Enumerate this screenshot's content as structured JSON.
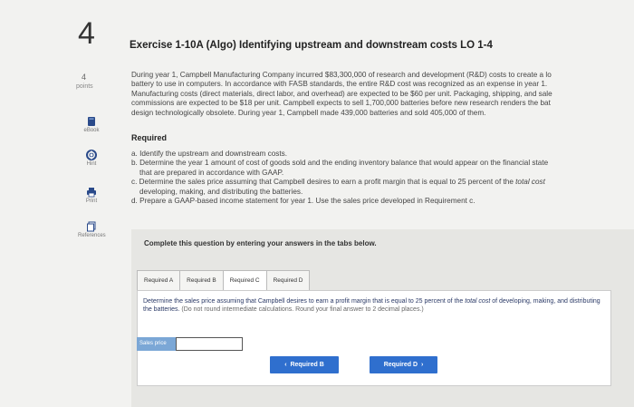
{
  "question": {
    "number": "4",
    "points_value": "4",
    "points_label": "points"
  },
  "sidebar": {
    "items": [
      {
        "label": "eBook",
        "icon": "book-icon"
      },
      {
        "label": "Hint",
        "icon": "lifebuoy-icon"
      },
      {
        "label": "Print",
        "icon": "print-icon"
      },
      {
        "label": "References",
        "icon": "references-icon"
      }
    ]
  },
  "exercise": {
    "title": "Exercise 1-10A (Algo) Identifying upstream and downstream costs LO 1-4",
    "paragraph_lines": [
      "During year 1, Campbell Manufacturing Company incurred $83,300,000 of research and development (R&D) costs to create a lo",
      "battery to use in computers. In accordance with FASB standards, the entire R&D cost was recognized as an expense in year 1.",
      "Manufacturing costs (direct materials, direct labor, and overhead) are expected to be $60 per unit. Packaging, shipping, and sale",
      "commissions are expected to be $18 per unit. Campbell expects to sell 1,700,000 batteries before new research renders the bat",
      "design technologically obsolete. During year 1, Campbell made 439,000 batteries and sold 405,000 of them."
    ],
    "required_heading": "Required",
    "required_items": {
      "a": "a. Identify the upstream and downstream costs.",
      "b1": "b. Determine the year 1 amount of cost of goods sold and the ending inventory balance that would appear on the financial state",
      "b2": "that are prepared in accordance with GAAP.",
      "c1": "c. Determine the sales price assuming that Campbell desires to earn a profit margin that is equal to 25 percent of the ",
      "c1_italic": "total cost",
      "c2": "developing, making, and distributing the batteries.",
      "d": "d. Prepare a GAAP-based income statement for year 1. Use the sales price developed in Requirement c."
    }
  },
  "answer_panel": {
    "instructions": "Complete this question by entering your answers in the tabs below.",
    "tabs": [
      {
        "label": "Required A",
        "active": false
      },
      {
        "label": "Required B",
        "active": false
      },
      {
        "label": "Required C",
        "active": true
      },
      {
        "label": "Required D",
        "active": false
      }
    ],
    "content": {
      "text_1": "Determine the sales price assuming that Campbell desires to earn a profit margin that is equal to 25 percent of the ",
      "text_italic": "total cost",
      "text_2": "of developing, making, and distributing the batteries. ",
      "note": "(Do not round intermediate calculations. Round your final answer to 2 decimal places.)"
    },
    "answer": {
      "label": "Sales price",
      "value": ""
    },
    "nav": {
      "prev_label": "Required B",
      "next_label": "Required D"
    }
  },
  "colors": {
    "button": "#2f6fce",
    "answer_label_bg": "#7ba7d6",
    "content_text": "#2b3a67"
  }
}
